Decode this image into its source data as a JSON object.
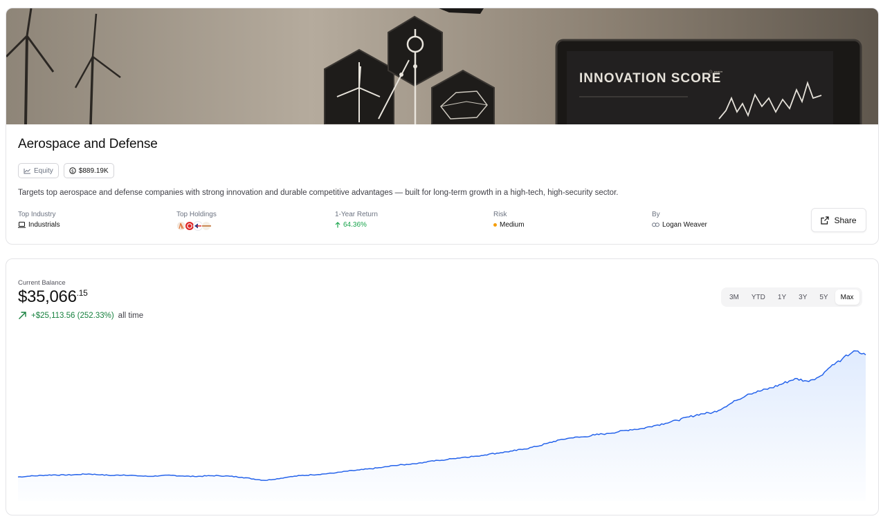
{
  "portfolio": {
    "title": "Aerospace and Defense",
    "badge_type": "Equity",
    "badge_value": "$889.19K",
    "description": "Targets top aerospace and defense companies with strong innovation and durable competitive advantages — built for long-term growth in a high-tech, high-security sector.",
    "hero_screen_text": "INNOVATION SCORE"
  },
  "stats": {
    "industry_label": "Top Industry",
    "industry_value": "Industrials",
    "holdings_label": "Top Holdings",
    "return_label": "1-Year Return",
    "return_value": "64.36%",
    "risk_label": "Risk",
    "risk_value": "Medium",
    "by_label": "By",
    "by_value": "Logan Weaver"
  },
  "actions": {
    "share_label": "Share"
  },
  "balance": {
    "label": "Current Balance",
    "main": "$35,066",
    "cents": ".15",
    "change": "+$25,113.56 (252.33%)",
    "change_suffix": "all time"
  },
  "ranges": [
    "3M",
    "YTD",
    "1Y",
    "3Y",
    "5Y",
    "Max"
  ],
  "selected_range": "Max",
  "colors": {
    "accent": "#2563eb",
    "positive": "#16a34a",
    "risk": "#f59e0b"
  },
  "chart_data": {
    "type": "area",
    "title": "",
    "xlabel": "",
    "ylabel": "",
    "grid": false,
    "y": [
      9950,
      10120,
      10280,
      10400,
      10340,
      10450,
      10580,
      10400,
      10260,
      10380,
      10230,
      10080,
      10190,
      10300,
      10150,
      10050,
      10170,
      10250,
      10100,
      9900,
      9550,
      9250,
      9600,
      9950,
      10250,
      10400,
      10580,
      10800,
      11150,
      11400,
      11650,
      11950,
      12300,
      12550,
      12800,
      13200,
      13400,
      13750,
      14050,
      14250,
      14650,
      14950,
      15300,
      15700,
      16200,
      16900,
      17600,
      18000,
      18200,
      18600,
      18900,
      19250,
      19700,
      19900,
      20500,
      21000,
      21600,
      22300,
      22950,
      23200,
      24300,
      25700,
      27000,
      27600,
      28300,
      29200,
      30200,
      29700,
      30500,
      32600,
      34200,
      35900,
      35066.15
    ]
  }
}
